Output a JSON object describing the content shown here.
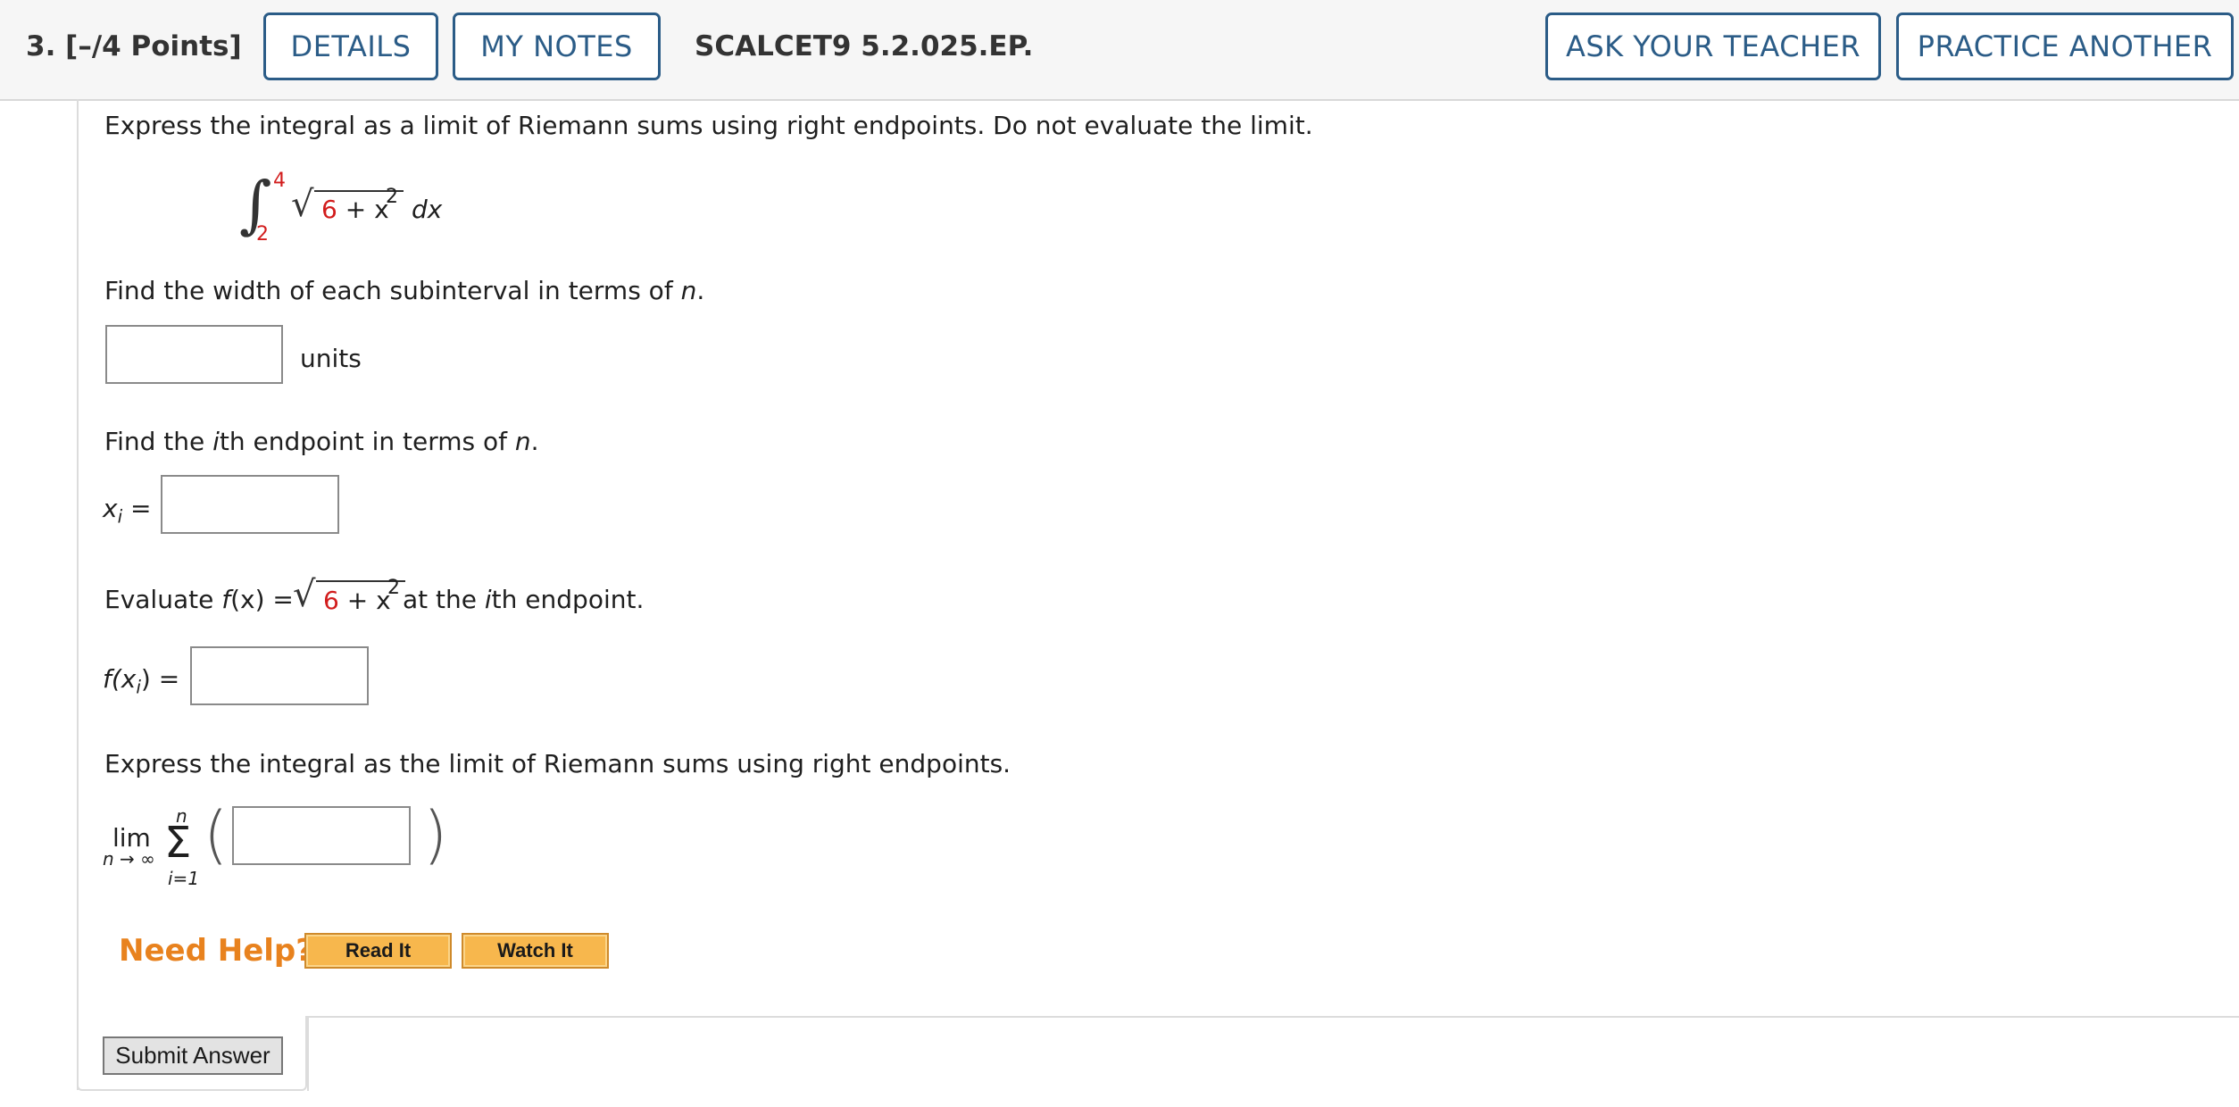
{
  "header": {
    "question_number": "3.",
    "points": "[–/4 Points]",
    "details_label": "DETAILS",
    "my_notes_label": "MY NOTES",
    "problem_code": "SCALCET9 5.2.025.EP.",
    "ask_teacher_label": "ASK YOUR TEACHER",
    "practice_another_label": "PRACTICE ANOTHER"
  },
  "problem": {
    "instruction": "Express the integral as a limit of Riemann sums using right endpoints. Do not evaluate the limit.",
    "integral": {
      "upper_limit": "4",
      "lower_limit": "2",
      "radicand_constant": "6",
      "radicand_rest": " + x",
      "exponent": "2",
      "differential": "dx",
      "sqrt_symbol": "√",
      "integral_symbol": "∫"
    },
    "step1": {
      "prompt_prefix": "Find the width of each subinterval in terms of ",
      "prompt_var": "n",
      "prompt_suffix": ".",
      "unit_label": "units",
      "value": ""
    },
    "step2": {
      "prompt_prefix": "Find the ",
      "prompt_var": "i",
      "prompt_suffix": "th endpoint in terms of ",
      "prompt_var2": "n",
      "prompt_end": ".",
      "label_x": "x",
      "label_sub": "i",
      "label_eq": "=",
      "value": ""
    },
    "step3": {
      "prompt_prefix": "Evaluate ",
      "func": "f",
      "func_arg": "(x)",
      "eq": " = ",
      "radicand_constant": "6",
      "radicand_rest": " + x",
      "exponent": "2",
      "prompt_suffix": " at the ",
      "prompt_var": "i",
      "prompt_end": "th endpoint.",
      "label_f": "f",
      "label_open": "(x",
      "label_sub": "i",
      "label_close": ")",
      "label_eq": "=",
      "value": ""
    },
    "step4": {
      "prompt": "Express the integral as the limit of Riemann sums using right endpoints.",
      "lim": "lim",
      "lim_sub": "n → ∞",
      "sigma": "Σ",
      "sigma_upper": "n",
      "sigma_lower": "i=1",
      "open_paren": "(",
      "close_paren": ")",
      "value": ""
    }
  },
  "help": {
    "label": "Need Help?",
    "read_it": "Read It",
    "watch_it": "Watch It"
  },
  "submit_label": "Submit Answer",
  "colors": {
    "accent": "#2b5c87",
    "highlight_red": "#d21d1d",
    "help_orange": "#e8821e",
    "help_button": "#f7b74d"
  }
}
